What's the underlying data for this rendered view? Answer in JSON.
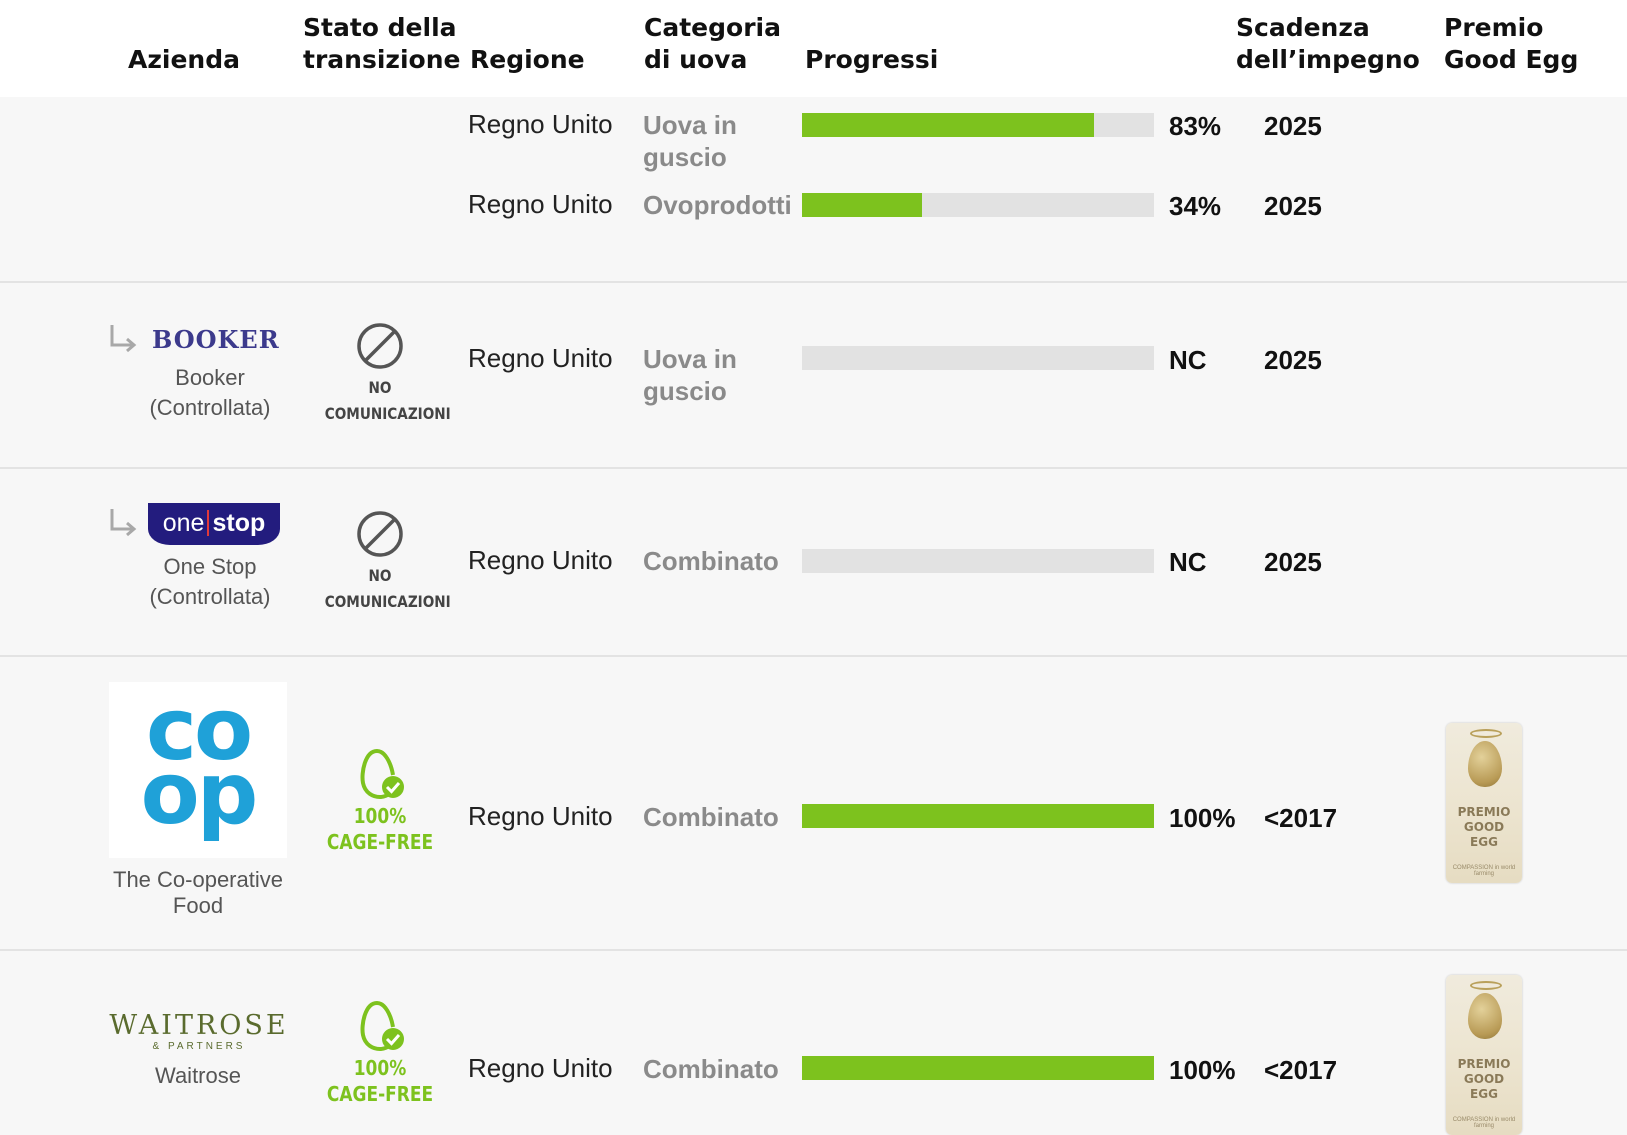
{
  "headers": {
    "company": [
      "Azienda"
    ],
    "status": [
      "Stato della",
      "transizione"
    ],
    "region": [
      "Regione"
    ],
    "category": [
      "Categoria",
      "di uova"
    ],
    "progress": [
      "Progressi"
    ],
    "deadline": [
      "Scadenza",
      "dell’impegno"
    ],
    "award": [
      "Premio",
      "Good Egg"
    ]
  },
  "rows": [
    {
      "entries": [
        {
          "region": "Regno Unito",
          "category": "Uova in guscio",
          "progress": 0.83,
          "progress_label": "83%",
          "deadline": "2025"
        },
        {
          "region": "Regno Unito",
          "category": "Ovoprodotti",
          "progress": 0.34,
          "progress_label": "34%",
          "deadline": "2025"
        }
      ]
    },
    {
      "company": {
        "logo": "BOOKER",
        "name_line1": "Booker",
        "name_line2": "(Controllata)"
      },
      "status": {
        "icon": "no-communication-icon",
        "line1": "NO",
        "line2": "COMUNICAZIONI"
      },
      "entries": [
        {
          "region": "Regno Unito",
          "category": "Uova in guscio",
          "progress": 0,
          "progress_label": "NC",
          "deadline": "2025"
        }
      ]
    },
    {
      "company": {
        "logo_part1": "one",
        "logo_part2": "stop",
        "name_line1": "One Stop",
        "name_line2": "(Controllata)"
      },
      "status": {
        "icon": "no-communication-icon",
        "line1": "NO",
        "line2": "COMUNICAZIONI"
      },
      "entries": [
        {
          "region": "Regno Unito",
          "category": "Combinato",
          "progress": 0,
          "progress_label": "NC",
          "deadline": "2025"
        }
      ]
    },
    {
      "company": {
        "logo_line1": "co",
        "logo_line2": "op",
        "name_line1": "The Co-operative",
        "name_line2": "Food"
      },
      "status": {
        "icon": "egg-check-icon",
        "line1": "100%",
        "line2": "CAGE-FREE"
      },
      "entries": [
        {
          "region": "Regno Unito",
          "category": "Combinato",
          "progress": 1.0,
          "progress_label": "100%",
          "deadline": "<2017"
        }
      ],
      "award": {
        "line1": "PREMIO",
        "line2": "GOOD",
        "line3": "EGG",
        "foot": "COMPASSION in world farming"
      }
    },
    {
      "company": {
        "logo_line1": "WAITROSE",
        "logo_line2": "& PARTNERS",
        "name_line1": "Waitrose"
      },
      "status": {
        "icon": "egg-check-icon",
        "line1": "100%",
        "line2": "CAGE-FREE"
      },
      "entries": [
        {
          "region": "Regno Unito",
          "category": "Combinato",
          "progress": 1.0,
          "progress_label": "100%",
          "deadline": "<2017"
        }
      ],
      "award": {
        "line1": "PREMIO",
        "line2": "GOOD",
        "line3": "EGG",
        "foot": "COMPASSION in world farming"
      }
    }
  ],
  "colors": {
    "progress_fill": "#7dc21e",
    "progress_track": "#e2e2e2",
    "booker_blue": "#3c3a8c",
    "onestop_blue": "#231c7e",
    "coop_blue": "#1fa1d8",
    "waitrose_green": "#5a6b2e"
  }
}
